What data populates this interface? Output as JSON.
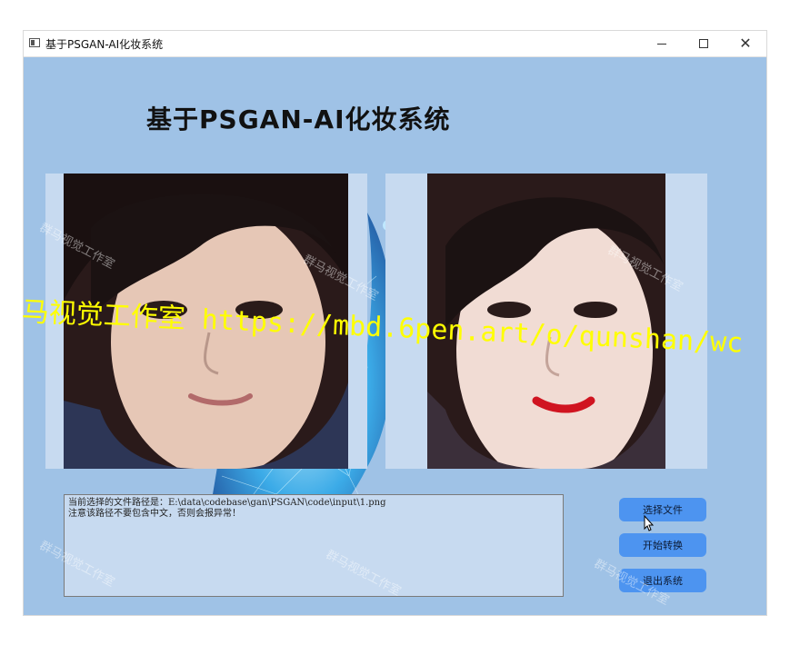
{
  "window": {
    "title": "基于PSGAN-AI化妆系统",
    "controls": {
      "minimize": "–",
      "maximize": "□",
      "close": "✕"
    }
  },
  "heading": "基于PSGAN-AI化妆系统",
  "images": {
    "source": {
      "description_icon": "face-photo-icon"
    },
    "result": {
      "description_icon": "face-photo-icon"
    }
  },
  "log": {
    "line1": "当前选择的文件路径是：E:\\data\\codebase\\gan\\PSGAN\\code\\input\\1.png",
    "line2": "注意该路径不要包含中文，否则会报异常！"
  },
  "buttons": {
    "select_file": "选择文件",
    "start_convert": "开始转换",
    "exit": "退出系统"
  },
  "overlay": "马视觉工作室 https://mbd.6pen.art/o/qunshan/wc",
  "watermark": "群马视觉工作室",
  "colors": {
    "window_bg": "#9fc2e6",
    "panel_bg": "#c7daf0",
    "button_bg": "#4d94f0",
    "overlay_text": "#ffff00"
  }
}
